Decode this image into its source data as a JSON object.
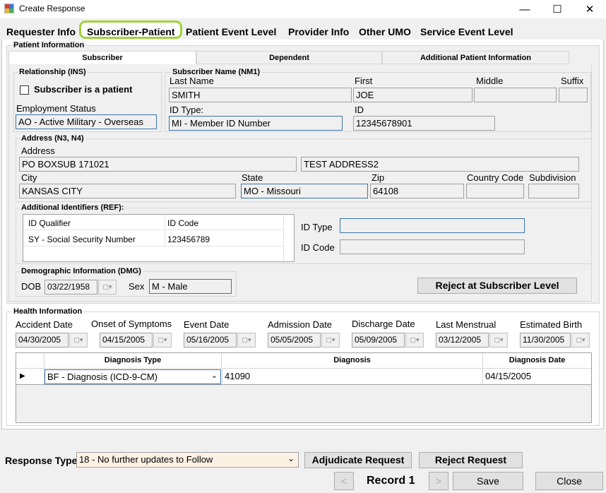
{
  "window": {
    "title": "Create Response"
  },
  "tabs": [
    "Requester Info",
    "Subscriber-Patient",
    "Patient Event Level",
    "Provider Info",
    "Other UMO",
    "Service Event Level"
  ],
  "patient_info": {
    "title": "Patient Information",
    "subtabs": [
      "Subscriber",
      "Dependent",
      "Additional Patient Information"
    ]
  },
  "relationship": {
    "title": "Relationship (INS)",
    "checkbox_label": "Subscriber is a patient",
    "checked": false,
    "employment_label": "Employment Status",
    "employment_value": "AO - Active Military - Overseas"
  },
  "subscriber_name": {
    "title": "Subscriber Name (NM1)",
    "last_label": "Last Name",
    "last": "SMITH",
    "first_label": "First",
    "first": "JOE",
    "middle_label": "Middle",
    "middle": "",
    "suffix_label": "Suffix",
    "suffix": "",
    "idtype_label": "ID Type:",
    "idtype": "MI - Member ID Number",
    "id_label": "ID",
    "id": "12345678901"
  },
  "address": {
    "title": "Address (N3, N4)",
    "address_label": "Address",
    "line1": "PO BOXSUB 171021",
    "line2": "TEST ADDRESS2",
    "city_label": "City",
    "city": "KANSAS CITY",
    "state_label": "State",
    "state": "MO - Missouri",
    "zip_label": "Zip",
    "zip": "64108",
    "country_label": "Country Code",
    "country": "",
    "subdivision_label": "Subdivision",
    "subdivision": ""
  },
  "additional_ids": {
    "title": "Additional Identifiers (REF):",
    "col_qualifier": "ID Qualifier",
    "col_code": "ID Code",
    "rows": [
      {
        "qualifier": "SY - Social Security Number",
        "code": "123456789"
      }
    ],
    "idtype_label": "ID Type",
    "idtype": "",
    "idcode_label": "ID Code",
    "idcode": ""
  },
  "demographic": {
    "title": "Demographic Information (DMG)",
    "dob_label": "DOB",
    "dob": "03/22/1958",
    "sex_label": "Sex",
    "sex": "M - Male"
  },
  "reject_subscriber_label": "Reject at Subscriber Level",
  "health": {
    "title": "Health Information",
    "dates": [
      {
        "label": "Accident Date",
        "value": "04/30/2005"
      },
      {
        "label": "Onset of Symptoms",
        "value": "04/15/2005"
      },
      {
        "label": "Event Date",
        "value": "05/16/2005"
      },
      {
        "label": "Admission Date",
        "value": "05/05/2005"
      },
      {
        "label": "Discharge Date",
        "value": "05/09/2005"
      },
      {
        "label": "Last Menstrual",
        "value": "03/12/2005"
      },
      {
        "label": "Estimated Birth",
        "value": "11/30/2005"
      }
    ],
    "grid": {
      "headers": [
        "Diagnosis Type",
        "Diagnosis",
        "Diagnosis Date"
      ],
      "rows": [
        {
          "type": "BF - Diagnosis (ICD-9-CM)",
          "diagnosis": "41090",
          "date": "04/15/2005"
        }
      ]
    }
  },
  "footer": {
    "response_type_label": "Response Type",
    "response_type_value": "18 - No further updates to Follow",
    "adjudicate_label": "Adjudicate Request",
    "reject_request_label": "Reject Request",
    "prev_label": "<",
    "record_label": "Record 1",
    "next_label": ">",
    "save_label": "Save",
    "close_label": "Close"
  },
  "colors": {
    "tab_highlight": "#9fd23b",
    "field_border_focus": "#3b74a8",
    "response_field_bg": "#fdf1e4"
  }
}
